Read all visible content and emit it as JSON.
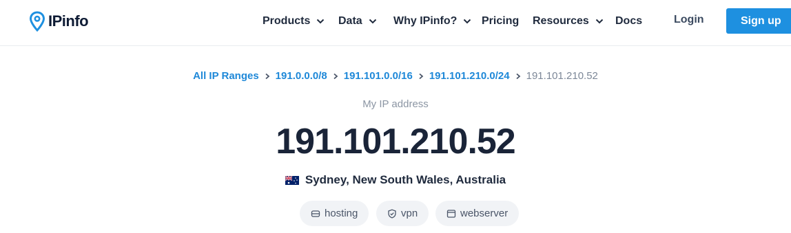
{
  "brand": {
    "name": "IPinfo",
    "accent": "#1e90e0",
    "text_color": "#0e1b34"
  },
  "nav": {
    "items": [
      {
        "label": "Products",
        "has_dropdown": true
      },
      {
        "label": "Data",
        "has_dropdown": true
      },
      {
        "label": "Why IPinfo?",
        "has_dropdown": true
      },
      {
        "label": "Pricing",
        "has_dropdown": false
      },
      {
        "label": "Resources",
        "has_dropdown": true
      },
      {
        "label": "Docs",
        "has_dropdown": false
      }
    ],
    "login_label": "Login",
    "signup_label": "Sign up"
  },
  "breadcrumb": {
    "links": [
      "All IP Ranges",
      "191.0.0.0/8",
      "191.101.0.0/16",
      "191.101.210.0/24"
    ],
    "current": "191.101.210.52"
  },
  "main": {
    "subtitle": "My IP address",
    "ip": "191.101.210.52",
    "location": "Sydney, New South Wales, Australia",
    "flag_icon": "australia-flag-icon"
  },
  "tags": [
    {
      "label": "hosting",
      "icon": "server-icon"
    },
    {
      "label": "vpn",
      "icon": "shield-check-icon"
    },
    {
      "label": "webserver",
      "icon": "browser-window-icon"
    }
  ]
}
